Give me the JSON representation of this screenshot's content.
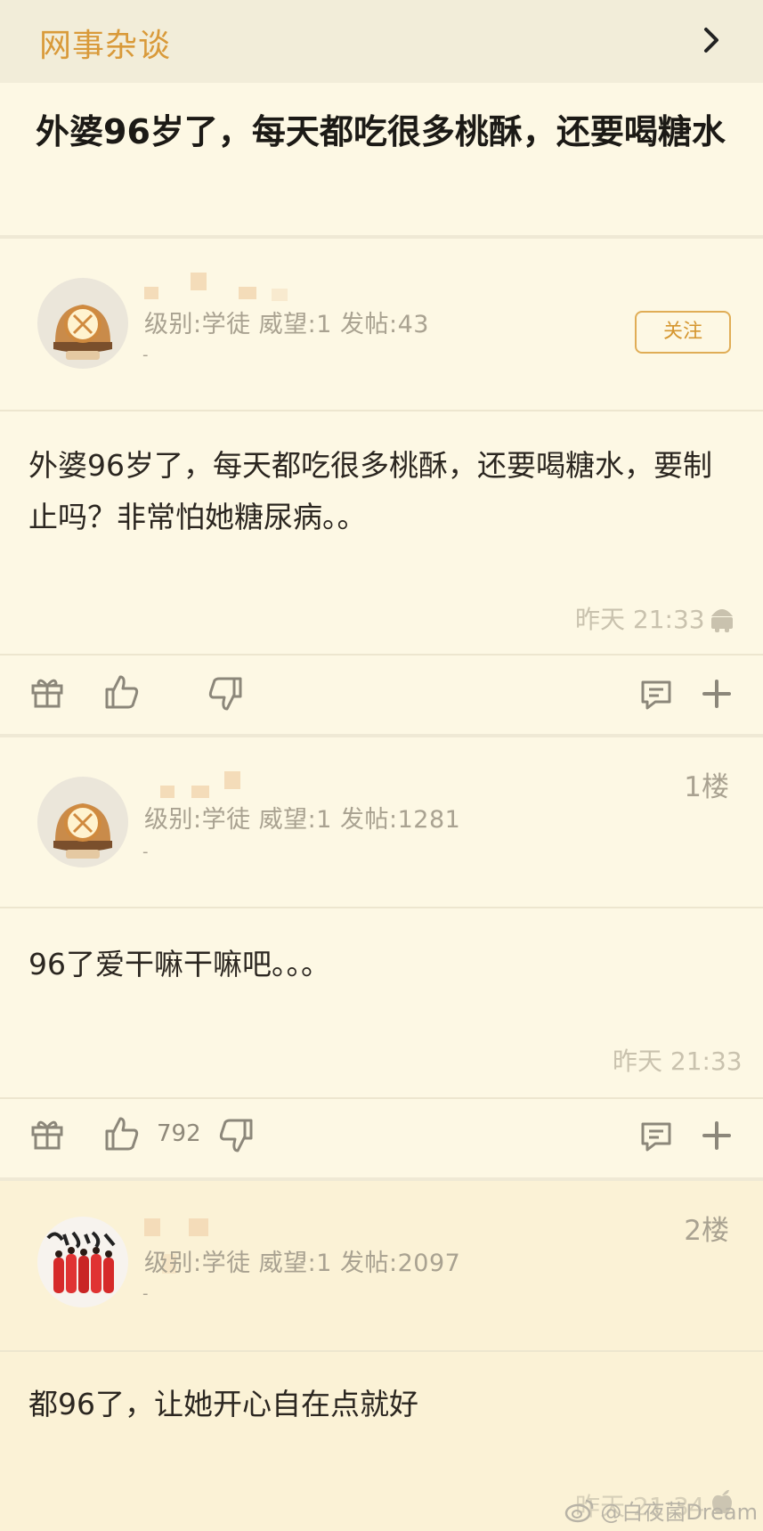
{
  "header": {
    "board_name": "网事杂谈"
  },
  "thread": {
    "title": "外婆96岁了，每天都吃很多桃酥，还要喝糖水"
  },
  "posts": [
    {
      "meta": "级别:学徒 威望:1 发帖:43",
      "dash": "-",
      "follow_label": "关注",
      "floor": "",
      "body": "外婆96岁了，每天都吃很多桃酥，还要喝糖水，要制止吗？非常怕她糖尿病。。",
      "time": "昨天 21:33",
      "likes": ""
    },
    {
      "meta": "级别:学徒 威望:1 发帖:1281",
      "dash": "-",
      "floor": "1楼",
      "body": "96了爱干嘛干嘛吧。。。",
      "time": "昨天 21:33",
      "likes": "792"
    },
    {
      "meta": "级别:学徒 威望:1 发帖:2097",
      "dash": "-",
      "floor": "2楼",
      "body": "都96了，让她开心自在点就好",
      "time": "昨天 21:34"
    }
  ],
  "watermark": "@白夜菌Dream",
  "icons": [
    "chevron-right-icon",
    "gift-icon",
    "thumbs-up-icon",
    "thumbs-down-icon",
    "comment-icon",
    "plus-icon",
    "android-icon",
    "apple-icon",
    "weibo-icon"
  ],
  "colors": {
    "accent": "#d99a3a",
    "background": "#fdf8e4",
    "meta_text": "#a9a291"
  }
}
